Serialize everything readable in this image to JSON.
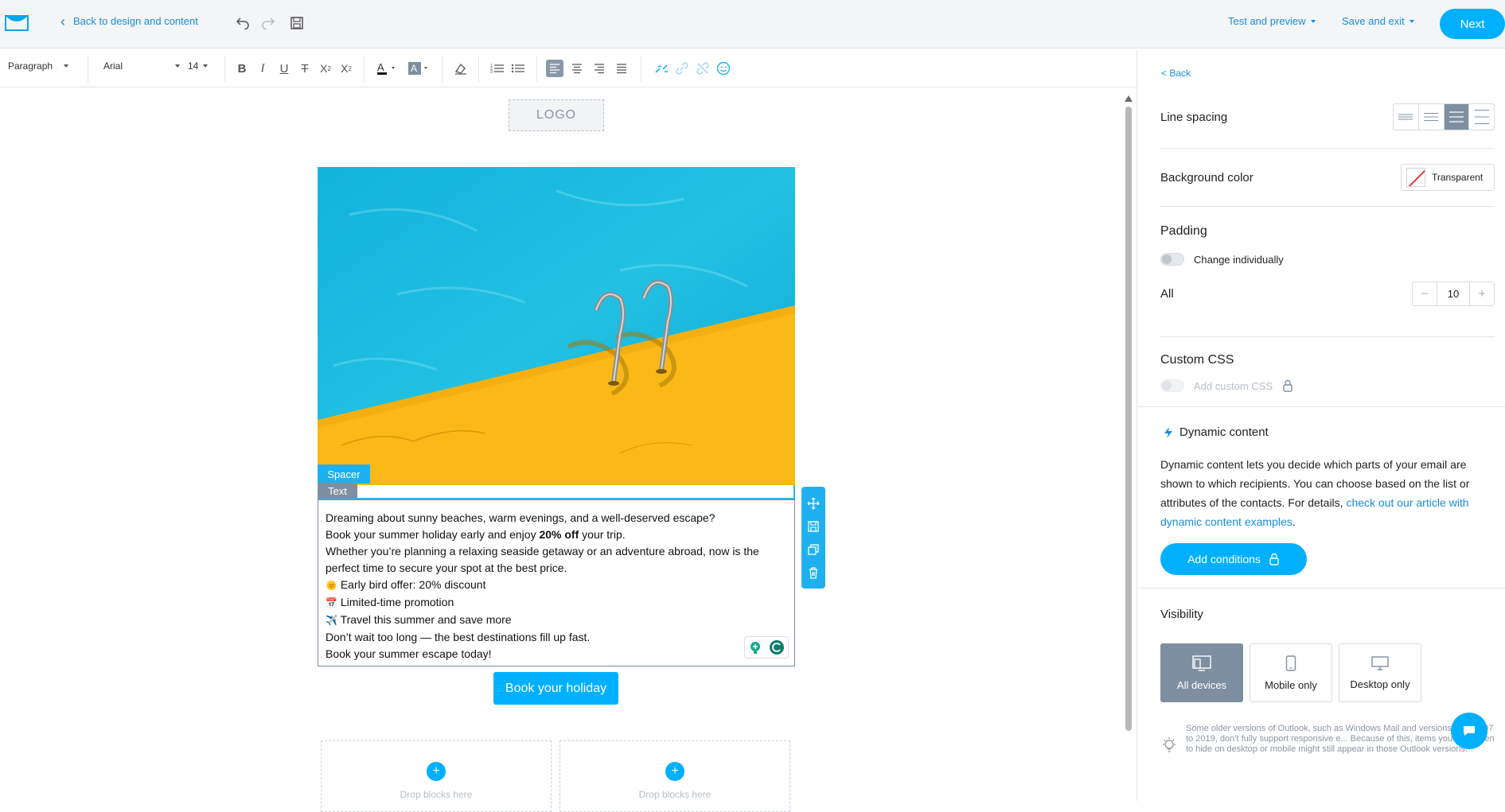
{
  "topbar": {
    "back_label": "Back to design and content",
    "test_label": "Test and preview",
    "save_exit_label": "Save and exit",
    "next_label": "Next"
  },
  "toolbar": {
    "paragraph": "Paragraph",
    "font": "Arial",
    "size": "14"
  },
  "canvas": {
    "logo_label": "LOGO",
    "spacer_tag": "Spacer",
    "text_tag": "Text",
    "text_lines": [
      "Dreaming about sunny beaches, warm evenings, and a well-deserved escape?",
      "Book your summer holiday early and enjoy ",
      "20% off",
      " your trip.",
      "Whether you’re planning a relaxing seaside getaway or an adventure abroad, now is the",
      "perfect time to secure your spot at the best price.",
      "Early bird offer: 20% discount",
      "Limited-time promotion",
      "Travel this summer and save more",
      "Don’t wait too long — the best destinations fill up fast.",
      "Book your summer escape today!"
    ],
    "emoji": [
      "🌞",
      "📅",
      "✈️"
    ],
    "cta_label": "Book your holiday",
    "drop_label": "Drop blocks here"
  },
  "panel": {
    "back_label": "< Back",
    "line_spacing_label": "Line spacing",
    "bg_color_label": "Background color",
    "bg_value": "Transparent",
    "padding_label": "Padding",
    "change_individually": "Change individually",
    "all_label": "All",
    "padding_value": "10",
    "custom_css_label": "Custom CSS",
    "add_custom_css": "Add custom CSS",
    "dynamic_title": "Dynamic content",
    "dynamic_desc": "Dynamic content lets you decide which parts of your email are shown to which recipients. You can choose based on the list or attributes of the contacts. For details, ",
    "dynamic_link": "check out our article with dynamic content examples",
    "dynamic_end": ".",
    "add_conditions": "Add conditions",
    "visibility_label": "Visibility",
    "vis_all": "All devices",
    "vis_mobile": "Mobile only",
    "vis_desktop": "Desktop only",
    "note": "Some older versions of Outlook, such as Windows Mail and versions from 2007 to 2019, don’t fully support responsive e... Because of this, items you’ve chosen to hide on desktop or mobile might still appear in those Outlook versions."
  },
  "colors": {
    "accent": "#00b0ff",
    "link": "#1a8cd8",
    "pool_blue": "#19b5dc",
    "pool_yellow": "#fbb917"
  }
}
